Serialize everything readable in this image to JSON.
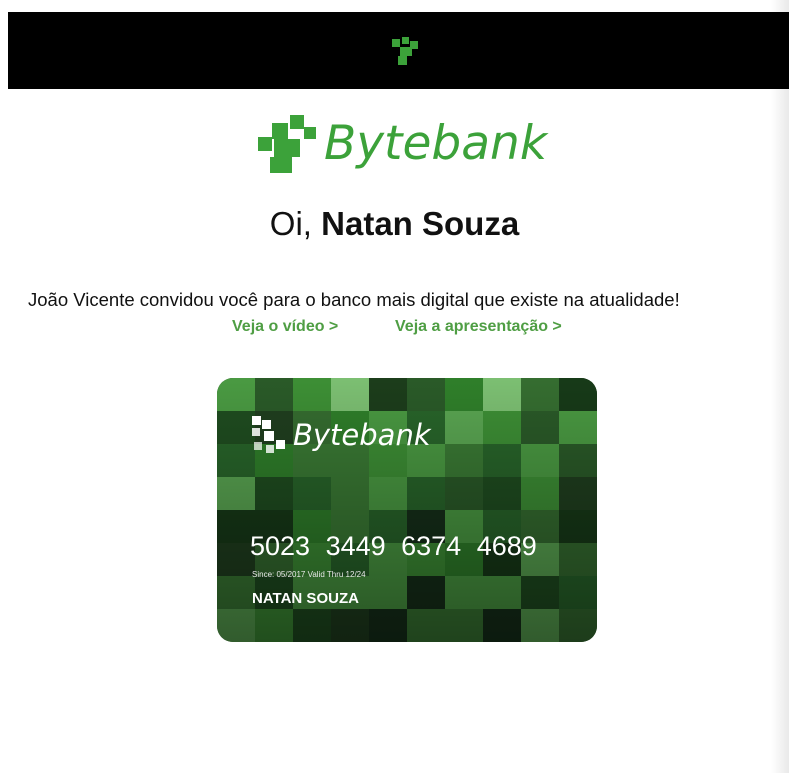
{
  "colors": {
    "brand_green": "#3ca23a",
    "link_green": "#4f9e44",
    "header_bg": "#000000",
    "card_dark": "#1d3a1a"
  },
  "header": {
    "logo_icon": "bytebank-mark-icon"
  },
  "brand": {
    "logo_icon": "bytebank-mark-icon",
    "name": "Bytebank"
  },
  "greeting": {
    "prefix": "Oi,",
    "name": "Natan Souza"
  },
  "invite": {
    "message": "João Vicente convidou você para o banco mais digital que existe na atualidade!",
    "links": {
      "video": "Veja o vídeo >",
      "presentation": "Veja a apresentação >"
    }
  },
  "card": {
    "brand": "Bytebank",
    "number": "5023 3449 6374 4689",
    "dates": "Since: 05/2017  Valid Thru 12/24",
    "holder": "NATAN SOUZA"
  }
}
